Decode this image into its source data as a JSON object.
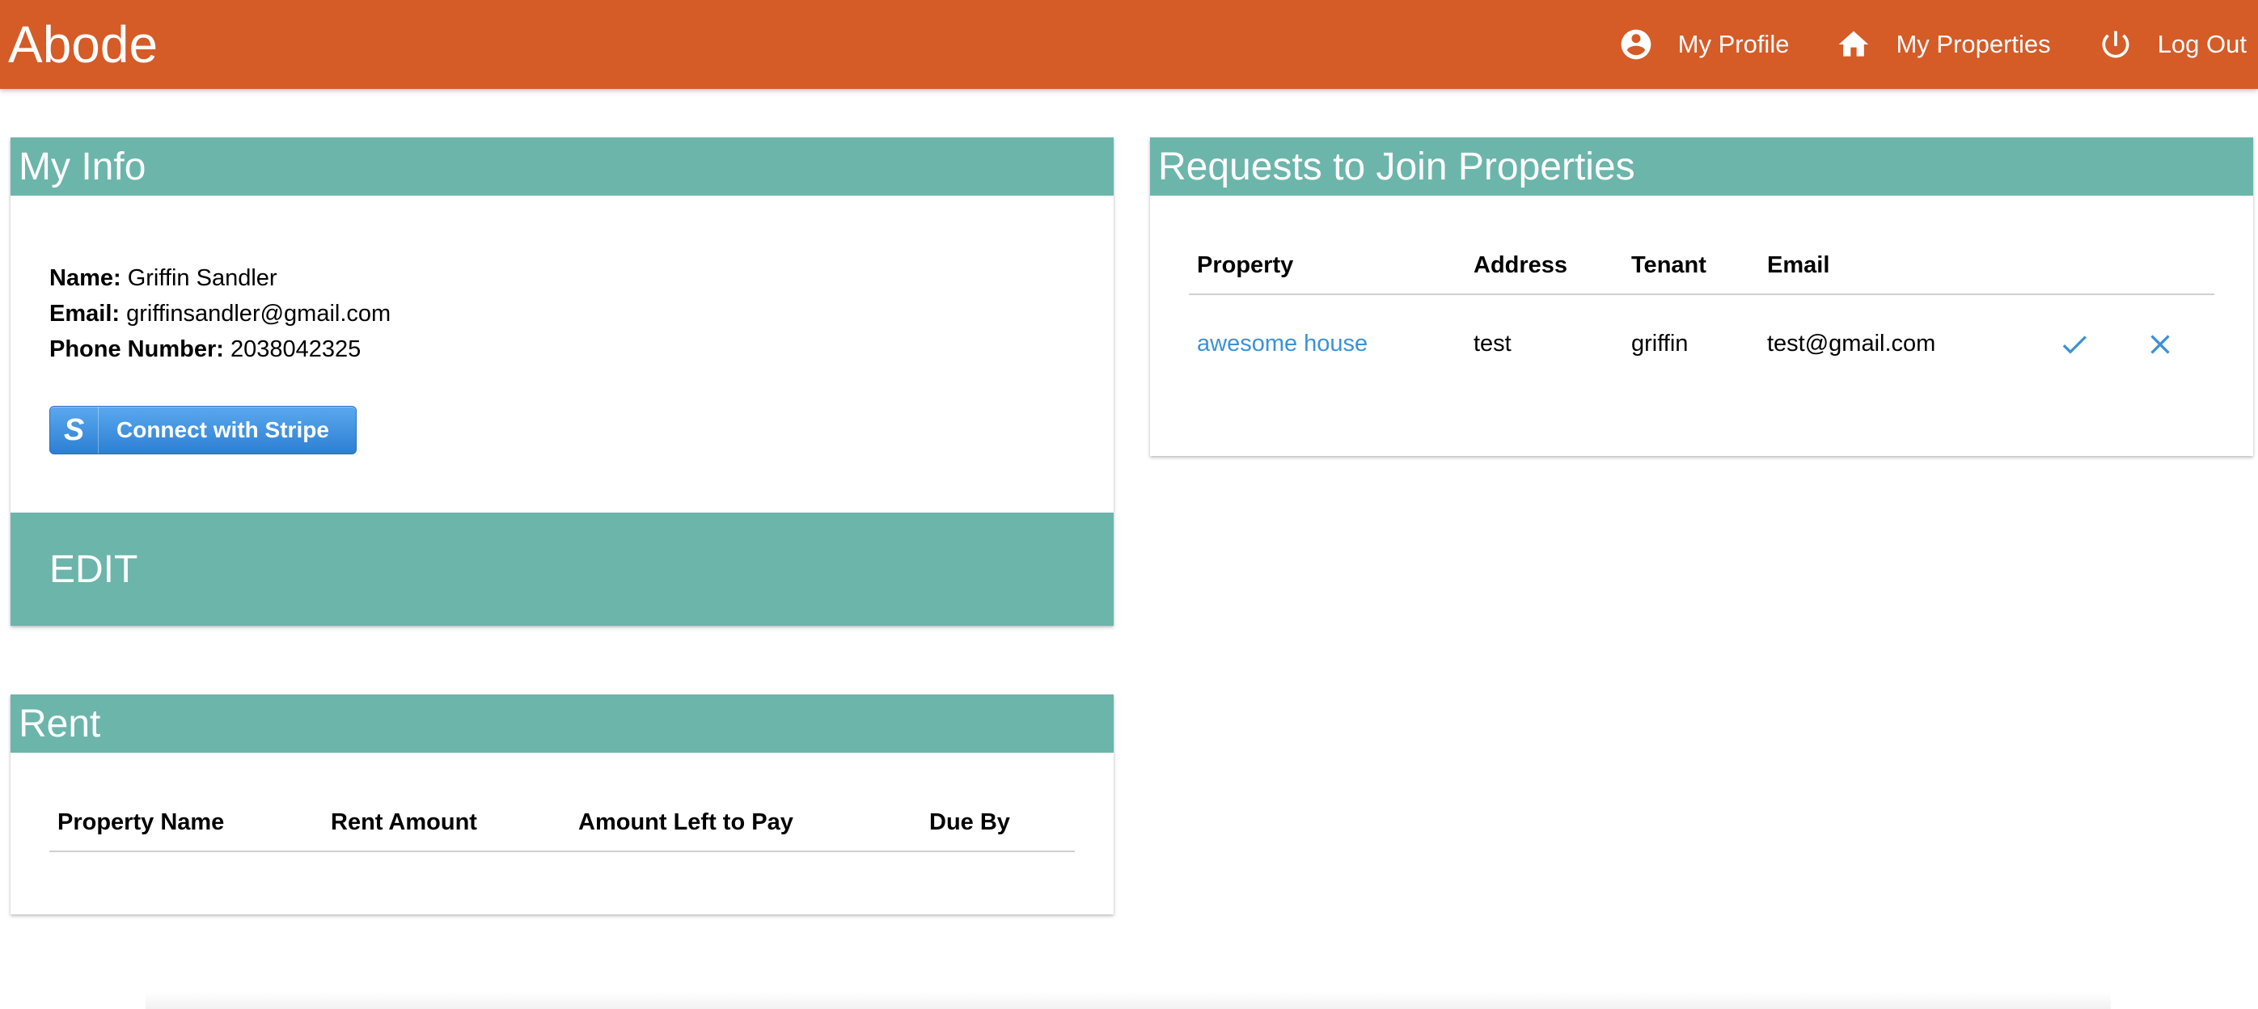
{
  "brand": "Abode",
  "nav": {
    "profile": {
      "label": "My Profile",
      "icon": "account-circle-icon"
    },
    "properties": {
      "label": "My Properties",
      "icon": "home-icon"
    },
    "logout": {
      "label": "Log Out",
      "icon": "power-icon"
    }
  },
  "colors": {
    "topbar": "#d55b27",
    "card_header": "#6cb5ab",
    "link": "#3b92d6"
  },
  "my_info": {
    "title": "My Info",
    "name_label": "Name:",
    "name_value": "Griffin Sandler",
    "email_label": "Email:",
    "email_value": "griffinsandler@gmail.com",
    "phone_label": "Phone Number:",
    "phone_value": "2038042325",
    "stripe_logo": "S",
    "stripe_button": "Connect with Stripe",
    "edit_button": "EDIT"
  },
  "rent": {
    "title": "Rent",
    "columns": [
      "Property Name",
      "Rent Amount",
      "Amount Left to Pay",
      "Due By"
    ]
  },
  "requests": {
    "title": "Requests to Join Properties",
    "columns": [
      "Property",
      "Address",
      "Tenant",
      "Email"
    ],
    "rows": [
      {
        "property": "awesome house",
        "address": "test",
        "tenant": "griffin",
        "email": "test@gmail.com"
      }
    ]
  }
}
